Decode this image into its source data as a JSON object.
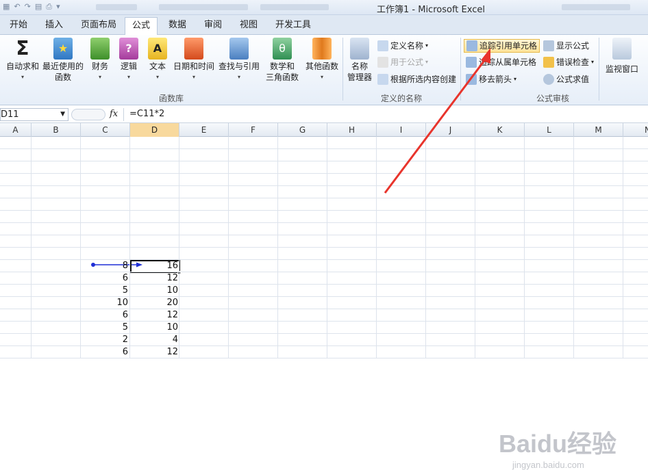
{
  "window": {
    "title": "工作簿1 - Microsoft Excel"
  },
  "tabs": [
    "开始",
    "插入",
    "页面布局",
    "公式",
    "数据",
    "审阅",
    "视图",
    "开发工具"
  ],
  "active_tab": "公式",
  "ribbon": {
    "function_library": {
      "label": "函数库",
      "buttons": [
        {
          "label": "自动求和",
          "icon": "sigma-icon"
        },
        {
          "label": "最近使用的\n函数",
          "icon": "star-book-icon"
        },
        {
          "label": "财务",
          "icon": "finance-book-icon"
        },
        {
          "label": "逻辑",
          "icon": "question-book-icon"
        },
        {
          "label": "文本",
          "icon": "text-book-icon"
        },
        {
          "label": "日期和时间",
          "icon": "clock-book-icon"
        },
        {
          "label": "查找与引用",
          "icon": "magnifier-book-icon"
        },
        {
          "label": "数学和\n三角函数",
          "icon": "theta-book-icon"
        },
        {
          "label": "其他函数",
          "icon": "books-icon"
        }
      ]
    },
    "defined_names": {
      "label": "定义的名称",
      "name_manager": "名称\n管理器",
      "define_name": "定义名称",
      "use_in_formula": "用于公式",
      "create_from_selection": "根据所选内容创建"
    },
    "formula_auditing": {
      "label": "公式审核",
      "trace_precedents": "追踪引用单元格",
      "trace_dependents": "追踪从属单元格",
      "remove_arrows": "移去箭头",
      "show_formulas": "显示公式",
      "error_checking": "错误检查",
      "evaluate_formula": "公式求值",
      "watch_window": "监视窗口"
    }
  },
  "formula_bar": {
    "name_box": "D11",
    "fx": "fx",
    "formula": "=C11*2"
  },
  "columns": [
    "A",
    "B",
    "C",
    "D",
    "E",
    "F",
    "G",
    "H",
    "I",
    "J",
    "K",
    "L",
    "M",
    "N"
  ],
  "selected_column": "D",
  "data_rows": [
    {
      "c": "8",
      "d": "16"
    },
    {
      "c": "6",
      "d": "12"
    },
    {
      "c": "5",
      "d": "10"
    },
    {
      "c": "10",
      "d": "20"
    },
    {
      "c": "6",
      "d": "12"
    },
    {
      "c": "5",
      "d": "10"
    },
    {
      "c": "2",
      "d": "4"
    },
    {
      "c": "6",
      "d": "12"
    }
  ],
  "watermark": {
    "brand": "Baidu经验",
    "url": "jingyan.baidu.com"
  },
  "colors": {
    "annotation_arrow": "#e8342c",
    "trace_arrow": "#1f2fd6",
    "selection_header": "#f8d99d"
  }
}
